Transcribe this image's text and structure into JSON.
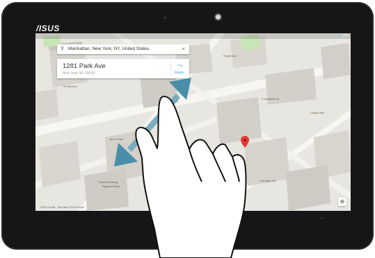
{
  "device": {
    "brand": "/ISUS"
  },
  "status_bar": {
    "right_text": "1:05"
  },
  "search": {
    "query": "Manhattan, New York, NY, United States",
    "clear_icon": "close-icon",
    "search_icon": "search-icon"
  },
  "place_card": {
    "title": "1281 Park Ave",
    "subtitle": "New York, NY 10029",
    "route_label": "Route"
  },
  "map": {
    "labels": {
      "l1": "W Holt Ave",
      "l2": "Pacific Ave",
      "l3": "E Hiawatha St",
      "l4": "Chapel Ave",
      "l5": "Jane & Ave",
      "l6": "Spectre Plaza",
      "l7": "Central Building",
      "l8": "Carnegie Hill"
    },
    "footer": "©2013 Google · Map data ©2013 Google",
    "marker_color": "#e53935"
  },
  "gesture": {
    "type": "pinch-zoom",
    "arrow_color": "#4a8fa9"
  }
}
